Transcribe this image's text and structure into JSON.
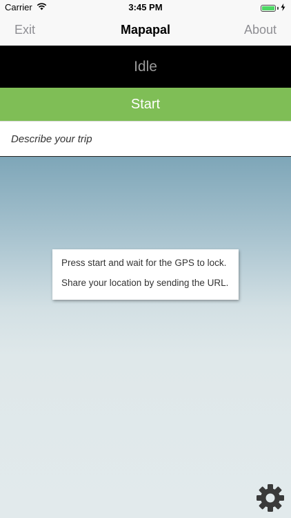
{
  "status_bar": {
    "carrier": "Carrier",
    "time": "3:45 PM",
    "battery_level": 1.0
  },
  "nav": {
    "left_label": "Exit",
    "title": "Mapapal",
    "right_label": "About"
  },
  "tracker": {
    "state": "Idle",
    "start_label": "Start"
  },
  "trip": {
    "placeholder": "Describe your trip",
    "value": ""
  },
  "info": {
    "line1": "Press start and wait for the GPS to lock.",
    "line2": "Share your location by sending the URL."
  },
  "icons": {
    "wifi": "wifi-icon",
    "battery": "battery-icon",
    "charging": "charging-bolt-icon",
    "settings": "gear-icon"
  },
  "colors": {
    "start_button": "#7fbe56",
    "status_panel": "#000000",
    "status_text": "#9a9a9a",
    "nav_buttons": "#8e8e93",
    "battery_fill": "#4cd964"
  }
}
